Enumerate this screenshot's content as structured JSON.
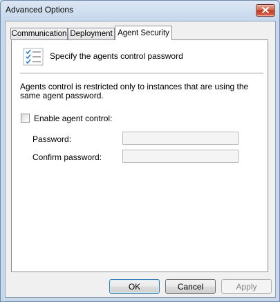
{
  "window": {
    "title": "Advanced Options"
  },
  "tabs": [
    {
      "label": "Communication"
    },
    {
      "label": "Deployment"
    },
    {
      "label": "Agent Security"
    }
  ],
  "panel": {
    "header_text": "Specify the agents control password",
    "description": "Agents control is restricted only to instances that are using the same agent password.",
    "enable_checkbox_label": "Enable agent control:",
    "enable_checked": false,
    "password_label": "Password:",
    "password_value": "",
    "confirm_label": "Confirm password:",
    "confirm_value": ""
  },
  "buttons": {
    "ok": "OK",
    "cancel": "Cancel",
    "apply": "Apply"
  },
  "icons": {
    "header": "checklist-icon",
    "close": "close-icon"
  }
}
